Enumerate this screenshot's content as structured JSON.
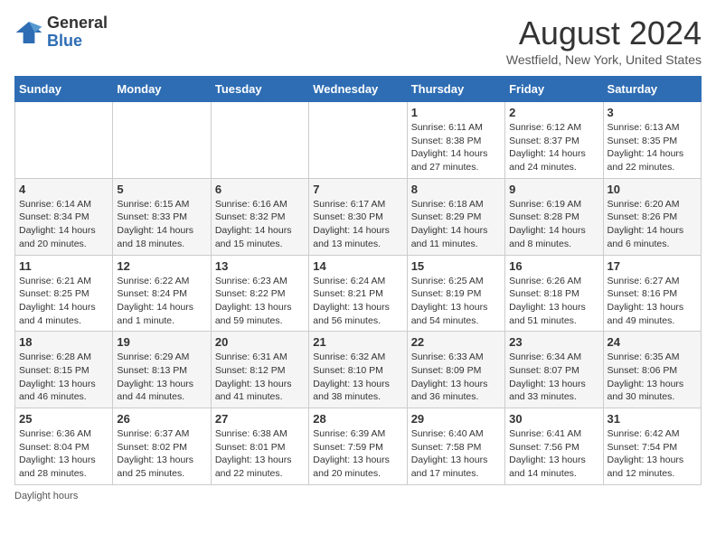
{
  "header": {
    "logo_line1": "General",
    "logo_line2": "Blue",
    "month_year": "August 2024",
    "location": "Westfield, New York, United States"
  },
  "days_of_week": [
    "Sunday",
    "Monday",
    "Tuesday",
    "Wednesday",
    "Thursday",
    "Friday",
    "Saturday"
  ],
  "weeks": [
    [
      {
        "day": "",
        "info": ""
      },
      {
        "day": "",
        "info": ""
      },
      {
        "day": "",
        "info": ""
      },
      {
        "day": "",
        "info": ""
      },
      {
        "day": "1",
        "info": "Sunrise: 6:11 AM\nSunset: 8:38 PM\nDaylight: 14 hours and 27 minutes."
      },
      {
        "day": "2",
        "info": "Sunrise: 6:12 AM\nSunset: 8:37 PM\nDaylight: 14 hours and 24 minutes."
      },
      {
        "day": "3",
        "info": "Sunrise: 6:13 AM\nSunset: 8:35 PM\nDaylight: 14 hours and 22 minutes."
      }
    ],
    [
      {
        "day": "4",
        "info": "Sunrise: 6:14 AM\nSunset: 8:34 PM\nDaylight: 14 hours and 20 minutes."
      },
      {
        "day": "5",
        "info": "Sunrise: 6:15 AM\nSunset: 8:33 PM\nDaylight: 14 hours and 18 minutes."
      },
      {
        "day": "6",
        "info": "Sunrise: 6:16 AM\nSunset: 8:32 PM\nDaylight: 14 hours and 15 minutes."
      },
      {
        "day": "7",
        "info": "Sunrise: 6:17 AM\nSunset: 8:30 PM\nDaylight: 14 hours and 13 minutes."
      },
      {
        "day": "8",
        "info": "Sunrise: 6:18 AM\nSunset: 8:29 PM\nDaylight: 14 hours and 11 minutes."
      },
      {
        "day": "9",
        "info": "Sunrise: 6:19 AM\nSunset: 8:28 PM\nDaylight: 14 hours and 8 minutes."
      },
      {
        "day": "10",
        "info": "Sunrise: 6:20 AM\nSunset: 8:26 PM\nDaylight: 14 hours and 6 minutes."
      }
    ],
    [
      {
        "day": "11",
        "info": "Sunrise: 6:21 AM\nSunset: 8:25 PM\nDaylight: 14 hours and 4 minutes."
      },
      {
        "day": "12",
        "info": "Sunrise: 6:22 AM\nSunset: 8:24 PM\nDaylight: 14 hours and 1 minute."
      },
      {
        "day": "13",
        "info": "Sunrise: 6:23 AM\nSunset: 8:22 PM\nDaylight: 13 hours and 59 minutes."
      },
      {
        "day": "14",
        "info": "Sunrise: 6:24 AM\nSunset: 8:21 PM\nDaylight: 13 hours and 56 minutes."
      },
      {
        "day": "15",
        "info": "Sunrise: 6:25 AM\nSunset: 8:19 PM\nDaylight: 13 hours and 54 minutes."
      },
      {
        "day": "16",
        "info": "Sunrise: 6:26 AM\nSunset: 8:18 PM\nDaylight: 13 hours and 51 minutes."
      },
      {
        "day": "17",
        "info": "Sunrise: 6:27 AM\nSunset: 8:16 PM\nDaylight: 13 hours and 49 minutes."
      }
    ],
    [
      {
        "day": "18",
        "info": "Sunrise: 6:28 AM\nSunset: 8:15 PM\nDaylight: 13 hours and 46 minutes."
      },
      {
        "day": "19",
        "info": "Sunrise: 6:29 AM\nSunset: 8:13 PM\nDaylight: 13 hours and 44 minutes."
      },
      {
        "day": "20",
        "info": "Sunrise: 6:31 AM\nSunset: 8:12 PM\nDaylight: 13 hours and 41 minutes."
      },
      {
        "day": "21",
        "info": "Sunrise: 6:32 AM\nSunset: 8:10 PM\nDaylight: 13 hours and 38 minutes."
      },
      {
        "day": "22",
        "info": "Sunrise: 6:33 AM\nSunset: 8:09 PM\nDaylight: 13 hours and 36 minutes."
      },
      {
        "day": "23",
        "info": "Sunrise: 6:34 AM\nSunset: 8:07 PM\nDaylight: 13 hours and 33 minutes."
      },
      {
        "day": "24",
        "info": "Sunrise: 6:35 AM\nSunset: 8:06 PM\nDaylight: 13 hours and 30 minutes."
      }
    ],
    [
      {
        "day": "25",
        "info": "Sunrise: 6:36 AM\nSunset: 8:04 PM\nDaylight: 13 hours and 28 minutes."
      },
      {
        "day": "26",
        "info": "Sunrise: 6:37 AM\nSunset: 8:02 PM\nDaylight: 13 hours and 25 minutes."
      },
      {
        "day": "27",
        "info": "Sunrise: 6:38 AM\nSunset: 8:01 PM\nDaylight: 13 hours and 22 minutes."
      },
      {
        "day": "28",
        "info": "Sunrise: 6:39 AM\nSunset: 7:59 PM\nDaylight: 13 hours and 20 minutes."
      },
      {
        "day": "29",
        "info": "Sunrise: 6:40 AM\nSunset: 7:58 PM\nDaylight: 13 hours and 17 minutes."
      },
      {
        "day": "30",
        "info": "Sunrise: 6:41 AM\nSunset: 7:56 PM\nDaylight: 13 hours and 14 minutes."
      },
      {
        "day": "31",
        "info": "Sunrise: 6:42 AM\nSunset: 7:54 PM\nDaylight: 13 hours and 12 minutes."
      }
    ]
  ],
  "footer": {
    "daylight_label": "Daylight hours"
  }
}
